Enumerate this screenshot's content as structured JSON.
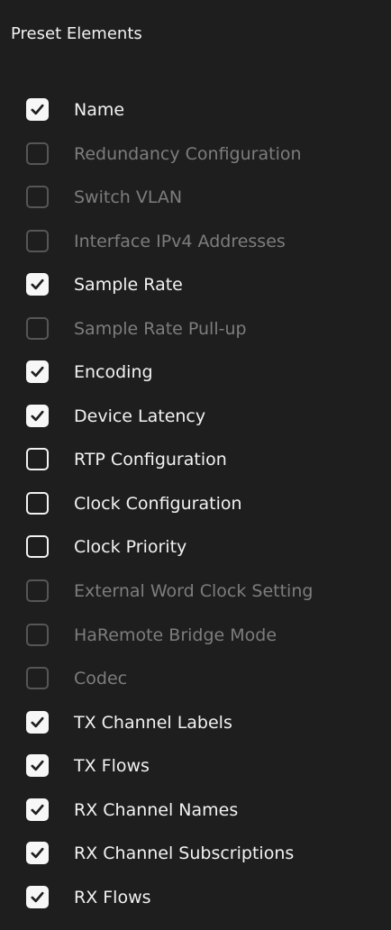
{
  "panel": {
    "title": "Preset Elements"
  },
  "items": [
    {
      "label": "Name",
      "checked": true,
      "enabled": true
    },
    {
      "label": "Redundancy Configuration",
      "checked": false,
      "enabled": false
    },
    {
      "label": "Switch VLAN",
      "checked": false,
      "enabled": false
    },
    {
      "label": "Interface IPv4 Addresses",
      "checked": false,
      "enabled": false
    },
    {
      "label": "Sample Rate",
      "checked": true,
      "enabled": true
    },
    {
      "label": "Sample Rate Pull-up",
      "checked": false,
      "enabled": false
    },
    {
      "label": "Encoding",
      "checked": true,
      "enabled": true
    },
    {
      "label": "Device Latency",
      "checked": true,
      "enabled": true
    },
    {
      "label": "RTP Configuration",
      "checked": false,
      "enabled": true
    },
    {
      "label": "Clock Configuration",
      "checked": false,
      "enabled": true
    },
    {
      "label": "Clock Priority",
      "checked": false,
      "enabled": true
    },
    {
      "label": "External Word Clock Setting",
      "checked": false,
      "enabled": false
    },
    {
      "label": "HaRemote Bridge Mode",
      "checked": false,
      "enabled": false
    },
    {
      "label": "Codec",
      "checked": false,
      "enabled": false
    },
    {
      "label": "TX Channel Labels",
      "checked": true,
      "enabled": true
    },
    {
      "label": "TX Flows",
      "checked": true,
      "enabled": true
    },
    {
      "label": "RX Channel Names",
      "checked": true,
      "enabled": true
    },
    {
      "label": "RX Channel Subscriptions",
      "checked": true,
      "enabled": true
    },
    {
      "label": "RX Flows",
      "checked": true,
      "enabled": true
    }
  ],
  "colors": {
    "background": "#1e1e1e",
    "text": "#f2f2f2",
    "disabled_text": "#7d7d7d",
    "disabled_border": "#565656",
    "check_fill": "#f7f7f7",
    "check_mark": "#1e1e1e"
  }
}
